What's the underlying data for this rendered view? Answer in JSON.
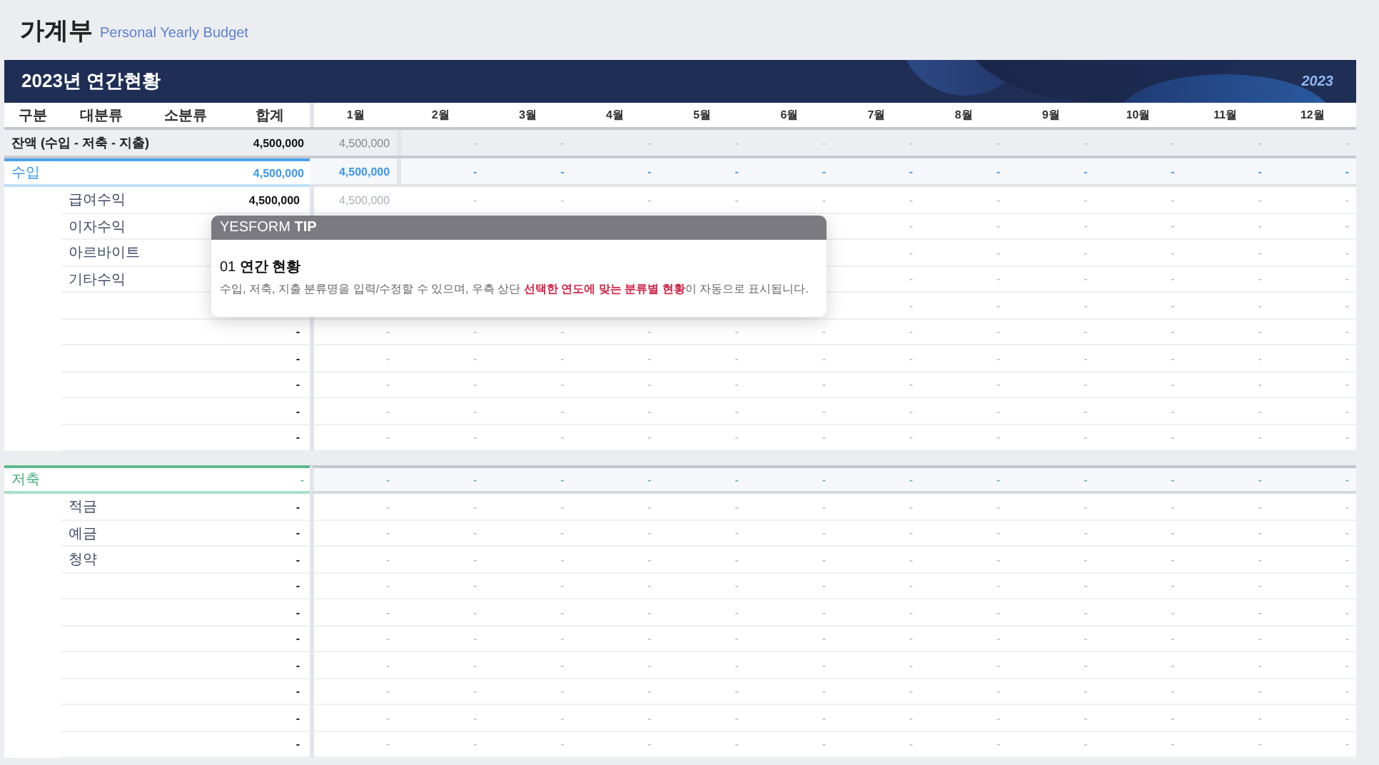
{
  "header": {
    "title": "가계부",
    "subtitle": "Personal Yearly Budget"
  },
  "banner": {
    "title": "2023년 연간현황",
    "year": "2023"
  },
  "columns": [
    "구분",
    "대분류",
    "소분류",
    "합계",
    "1월",
    "2월",
    "3월",
    "4월",
    "5월",
    "6월",
    "7월",
    "8월",
    "9월",
    "10월",
    "11월",
    "12월"
  ],
  "sections": [
    {
      "rows": [
        {
          "kind": "balance",
          "label": "잔액 (수입 - 저축 - 지출)",
          "total": "4,500,000",
          "months": [
            "4,500,000",
            "-",
            "-",
            "-",
            "-",
            "-",
            "-",
            "-",
            "-",
            "-",
            "-",
            "-"
          ]
        },
        {
          "kind": "income",
          "label": "수입",
          "total": "4,500,000",
          "months": [
            "4,500,000",
            "-",
            "-",
            "-",
            "-",
            "-",
            "-",
            "-",
            "-",
            "-",
            "-",
            "-"
          ]
        },
        {
          "kind": "item",
          "label": "급여수익",
          "total": "4,500,000",
          "months": [
            "4,500,000",
            "-",
            "-",
            "-",
            "-",
            "-",
            "-",
            "-",
            "-",
            "-",
            "-",
            "-"
          ]
        },
        {
          "kind": "item",
          "label": "이자수익",
          "months": [
            "-",
            "-",
            "-",
            "-",
            "-",
            "-"
          ]
        },
        {
          "kind": "item",
          "label": "아르바이트",
          "months": [
            "-",
            "-",
            "-",
            "-",
            "-",
            "-"
          ]
        },
        {
          "kind": "item",
          "label": "기타수익",
          "months": [
            "-",
            "-",
            "-",
            "-",
            "-",
            "-"
          ]
        },
        {
          "kind": "item",
          "months": [
            "-",
            "-",
            "-",
            "-",
            "-",
            "-"
          ]
        },
        {
          "kind": "item",
          "total": "-",
          "months": [
            "-",
            "-",
            "-",
            "-",
            "-",
            "-",
            "-",
            "-",
            "-",
            "-",
            "-",
            "-"
          ]
        },
        {
          "kind": "item",
          "total": "-",
          "months": [
            "-",
            "-",
            "-",
            "-",
            "-",
            "-",
            "-",
            "-",
            "-",
            "-",
            "-",
            "-"
          ]
        },
        {
          "kind": "item",
          "total": "-",
          "months": [
            "-",
            "-",
            "-",
            "-",
            "-",
            "-",
            "-",
            "-",
            "-",
            "-",
            "-",
            "-"
          ]
        },
        {
          "kind": "item",
          "total": "-",
          "months": [
            "-",
            "-",
            "-",
            "-",
            "-",
            "-",
            "-",
            "-",
            "-",
            "-",
            "-",
            "-"
          ]
        },
        {
          "kind": "item",
          "total": "-",
          "months": [
            "-",
            "-",
            "-",
            "-",
            "-",
            "-",
            "-",
            "-",
            "-",
            "-",
            "-",
            "-"
          ]
        }
      ]
    },
    {
      "rows": [
        {
          "kind": "savings",
          "label": "저축",
          "total": "-",
          "months": [
            "-",
            "-",
            "-",
            "-",
            "-",
            "-",
            "-",
            "-",
            "-",
            "-",
            "-",
            "-"
          ]
        },
        {
          "kind": "item",
          "label": "적금",
          "total": "-",
          "months": [
            "-",
            "-",
            "-",
            "-",
            "-",
            "-",
            "-",
            "-",
            "-",
            "-",
            "-",
            "-"
          ]
        },
        {
          "kind": "item",
          "label": "예금",
          "total": "-",
          "months": [
            "-",
            "-",
            "-",
            "-",
            "-",
            "-",
            "-",
            "-",
            "-",
            "-",
            "-",
            "-"
          ]
        },
        {
          "kind": "item",
          "label": "청약",
          "total": "-",
          "months": [
            "-",
            "-",
            "-",
            "-",
            "-",
            "-",
            "-",
            "-",
            "-",
            "-",
            "-",
            "-"
          ]
        },
        {
          "kind": "item",
          "total": "-",
          "months": [
            "-",
            "-",
            "-",
            "-",
            "-",
            "-",
            "-",
            "-",
            "-",
            "-",
            "-",
            "-"
          ]
        },
        {
          "kind": "item",
          "total": "-",
          "months": [
            "-",
            "-",
            "-",
            "-",
            "-",
            "-",
            "-",
            "-",
            "-",
            "-",
            "-",
            "-"
          ]
        },
        {
          "kind": "item",
          "total": "-",
          "months": [
            "-",
            "-",
            "-",
            "-",
            "-",
            "-",
            "-",
            "-",
            "-",
            "-",
            "-",
            "-"
          ]
        },
        {
          "kind": "item",
          "total": "-",
          "months": [
            "-",
            "-",
            "-",
            "-",
            "-",
            "-",
            "-",
            "-",
            "-",
            "-",
            "-",
            "-"
          ]
        },
        {
          "kind": "item",
          "total": "-",
          "months": [
            "-",
            "-",
            "-",
            "-",
            "-",
            "-",
            "-",
            "-",
            "-",
            "-",
            "-",
            "-"
          ]
        },
        {
          "kind": "item",
          "total": "-",
          "months": [
            "-",
            "-",
            "-",
            "-",
            "-",
            "-",
            "-",
            "-",
            "-",
            "-",
            "-",
            "-"
          ]
        },
        {
          "kind": "item",
          "total": "-",
          "months": [
            "-",
            "-",
            "-",
            "-",
            "-",
            "-",
            "-",
            "-",
            "-",
            "-",
            "-",
            "-"
          ]
        }
      ]
    }
  ],
  "tip": {
    "label": "YESFORM **TIP**",
    "title": "01 **연간 현황**",
    "text": "수입, 저축, 지출 분류명을 입력/수정할 수 있으며, 우측 상단 **선택한 연도에 맞는 분류별 현황**이 자동으로 표시됩니다."
  }
}
